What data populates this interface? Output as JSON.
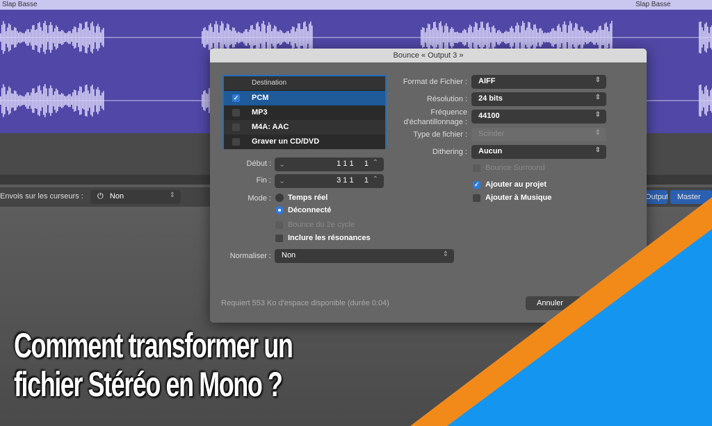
{
  "track": {
    "name_left": "Slap Basse",
    "name_right": "Slap Basse",
    "loop_icon": "loop-icon"
  },
  "mixer": {
    "sends_label": "Envois sur les curseurs :",
    "sends_value": "Non",
    "output_button": "Output",
    "master_button": "Master"
  },
  "dialog": {
    "title": "Bounce « Output 3 »",
    "destination_header": "Destination",
    "destinations": [
      {
        "label": "PCM",
        "checked": true
      },
      {
        "label": "MP3",
        "checked": false
      },
      {
        "label": "M4A: AAC",
        "checked": false
      },
      {
        "label": "Graver un CD/DVD",
        "checked": false
      }
    ],
    "start_label": "Début :",
    "start_value": "1 1 1     1",
    "end_label": "Fin :",
    "end_value": "3 1 1     1",
    "mode_label": "Mode :",
    "mode_realtime": "Temps réel",
    "mode_offline": "Déconnecté",
    "mode_selected": "Déconnecté",
    "bounce_cycle": "Bounce du 2e cycle",
    "include_tails": "Inclure les résonances",
    "normalize_label": "Normaliser :",
    "normalize_value": "Non",
    "format_label": "Format de Fichier :",
    "format_value": "AIFF",
    "resolution_label": "Résolution :",
    "resolution_value": "24 bits",
    "samplerate_label_1": "Fréquence",
    "samplerate_label_2": "d'échantillonnage :",
    "samplerate_value": "44100",
    "filetype_label": "Type de fichier :",
    "filetype_value": "Scinder",
    "dithering_label": "Dithering :",
    "dithering_value": "Aucun",
    "bounce_surround": "Bounce Surround",
    "add_to_project": "Ajouter au projet",
    "add_to_project_checked": true,
    "add_to_music": "Ajouter à Musique",
    "add_to_music_checked": false,
    "status": "Requiert 553 Ko d'espace disponible (durée 0:04)",
    "cancel_button": "Annuler"
  },
  "overlay": {
    "title_line1": "Comment transformer un",
    "title_line2": "fichier Stéréo en Mono ?",
    "colors": {
      "orange": "#f28a1a",
      "blue": "#1496f0"
    }
  }
}
